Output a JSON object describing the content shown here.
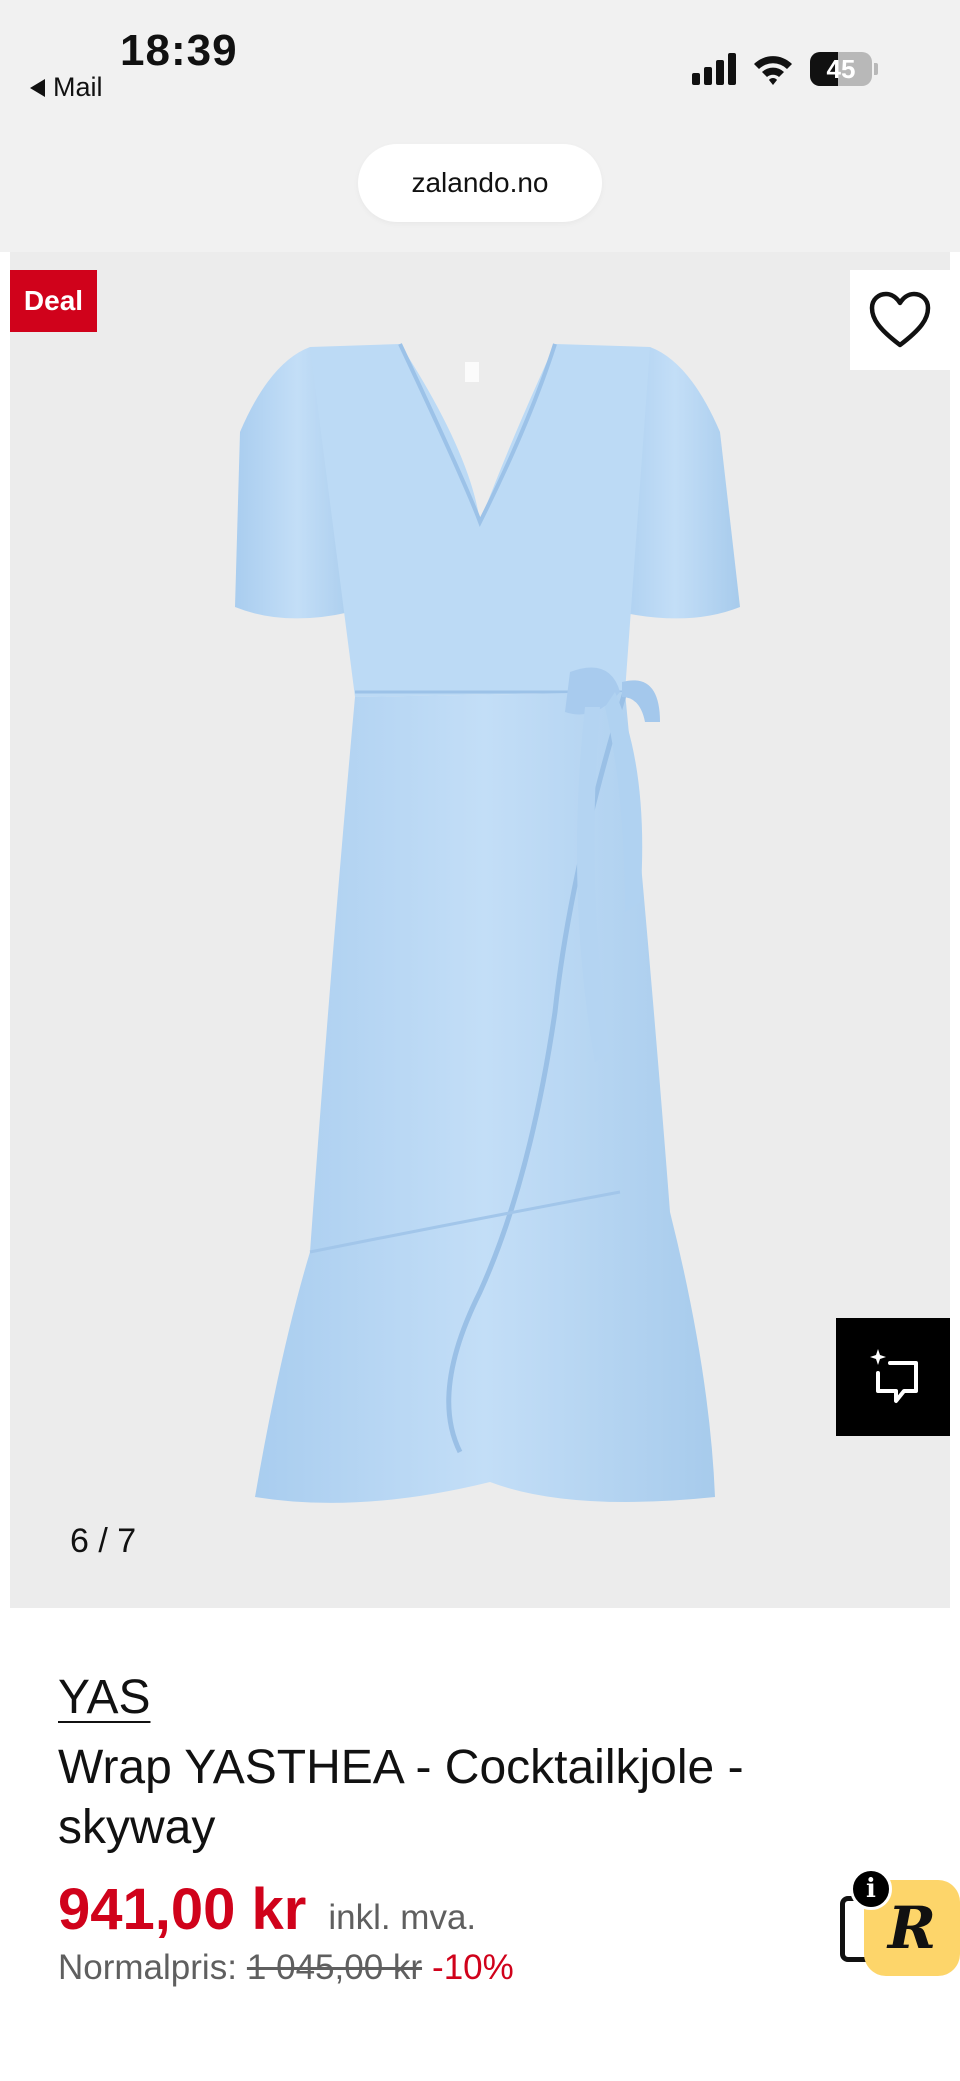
{
  "status_bar": {
    "back_app": "Mail",
    "time": "18:39",
    "battery_level": "45",
    "battery_fraction": 0.45
  },
  "browser": {
    "url": "zalando.no"
  },
  "gallery": {
    "deal_badge": "Deal",
    "counter": "6 / 7",
    "current_image": 6,
    "total_images": 7,
    "favorite_icon": "heart-outline-icon",
    "ai_icon": "sparkle-comment-icon",
    "dress_color": "#bcdaf5"
  },
  "product": {
    "brand": "YAS",
    "title": "Wrap YASTHEA - Cocktailkjole - skyway",
    "price": "941,00 kr",
    "vat_note": "inkl. mva.",
    "normal_label": "Normalpris:",
    "normal_price": "1 045,00 kr",
    "discount": "-10%"
  },
  "extension": {
    "letter": "R",
    "info_glyph": "i"
  },
  "colors": {
    "accent_red": "#d0021b",
    "badge_yellow": "#fdd56a",
    "image_bg": "#ececec"
  }
}
